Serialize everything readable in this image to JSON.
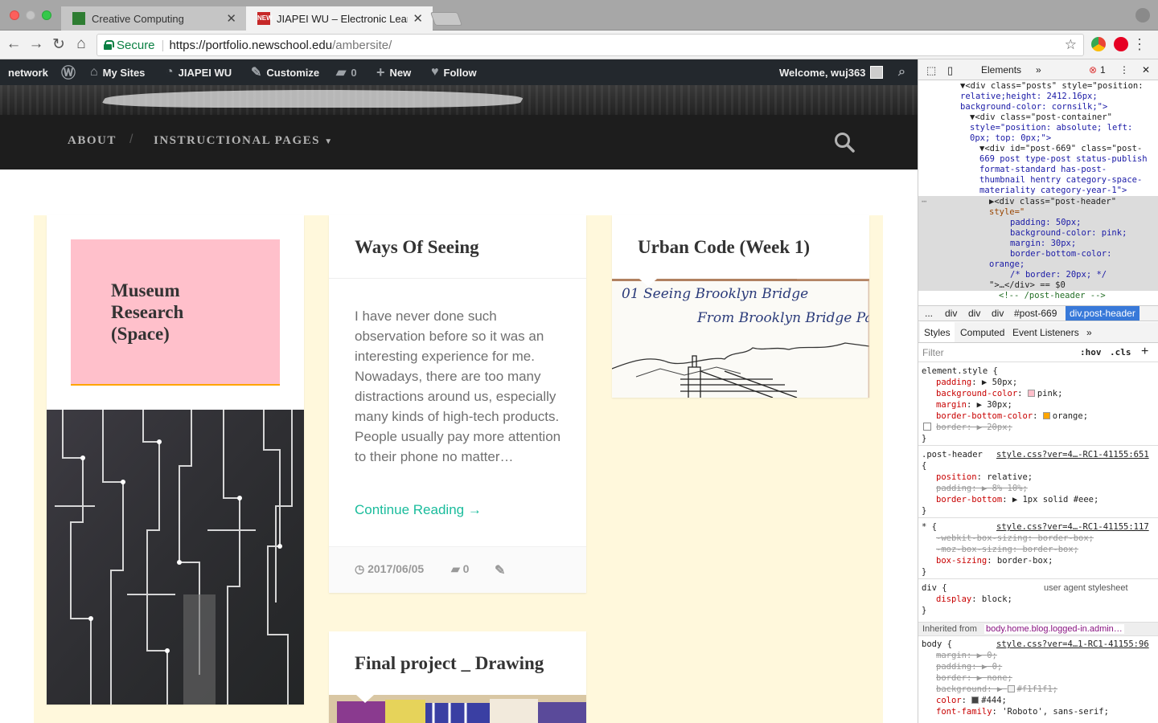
{
  "browser": {
    "tabs": [
      {
        "title": "Creative Computing",
        "favicon_color": "#2e7d32"
      },
      {
        "title": "JIAPEI WU – Electronic Learning",
        "favicon_color": "#c62828",
        "favicon_text": "NEW"
      }
    ],
    "tab_close": "✕",
    "secure_label": "Secure",
    "url_host": "https://portfolio.newschool.edu",
    "url_path": "/ambersite/"
  },
  "adminbar": {
    "network": "network",
    "my_sites": "My Sites",
    "site_name": "JIAPEI WU",
    "customize": "Customize",
    "comments_count": "0",
    "new": "New",
    "follow": "Follow",
    "welcome": "Welcome, wuj363"
  },
  "sitenav": {
    "about": "ABOUT",
    "separator": "/",
    "instructional": "INSTRUCTIONAL PAGES"
  },
  "posts": [
    {
      "title": "Museum Research (Space)"
    },
    {
      "title": "Ways Of Seeing",
      "excerpt": "  I have never done such observation before so it was an interesting experience for me. Nowadays, there are too many distractions around us, especially many kinds of high-tech products. People usually pay more attention to their phone no matter…",
      "continue": "Continue Reading →",
      "date": "2017/06/05",
      "comments": "0"
    },
    {
      "title": "Urban Code (Week 1)",
      "sketch_line1": "01  Seeing  Brooklyn Bridge",
      "sketch_line2": "From  Brooklyn  Bridge Park"
    },
    {
      "title": "Final project _ Drawing"
    }
  ],
  "devtools": {
    "tab_elements": "Elements",
    "errors": "1",
    "dom_lines": [
      "▼<div class=\"posts\" style=\"position:",
      "relative;height: 2412.16px;",
      "background-color: cornsilk;\">",
      "▼<div class=\"post-container\"",
      "style=\"position: absolute; left:",
      "0px; top: 0px;\">",
      "▼<div id=\"post-669\" class=\"post-",
      "669 post type-post status-publish",
      "format-standard has-post-",
      "thumbnail hentry category-space-",
      "materiality category-year-1\">",
      "▶<div class=\"post-header\"",
      "style=\"",
      "padding: 50px;",
      "background-color: pink;",
      "margin: 30px;",
      "border-bottom-color:",
      "orange;",
      "/* border: 20px; */",
      "\">…</div> == $0",
      "<!-- /post-header -->"
    ],
    "crumbs": [
      "...",
      "div",
      "div",
      "div",
      "#post-669",
      "div.post-header"
    ],
    "style_tabs": [
      "Styles",
      "Computed",
      "Event Listeners"
    ],
    "filter_placeholder": "Filter",
    "hov": ":hov",
    "cls": ".cls",
    "rules": {
      "element_style": "element.style {",
      "es_props": [
        [
          "padding",
          "50px;"
        ],
        [
          "background-color",
          "pink;"
        ],
        [
          "margin",
          "30px;"
        ],
        [
          "border-bottom-color",
          "orange;"
        ],
        [
          "border",
          "20px;"
        ]
      ],
      "post_header_sel": ".post-header",
      "post_header_src": "style.css?ver=4…-RC1-41155:651",
      "ph_props": [
        [
          "position",
          "relative;"
        ],
        [
          "padding",
          "8% 10%;"
        ],
        [
          "border-bottom",
          "1px solid #eee;"
        ]
      ],
      "star_sel": "* {",
      "star_src": "style.css?ver=4…-RC1-41155:117",
      "star_props": [
        [
          "-webkit-box-sizing",
          "border-box;"
        ],
        [
          "-moz-box-sizing",
          "border-box;"
        ],
        [
          "box-sizing",
          "border-box;"
        ]
      ],
      "div_sel": "div {",
      "ua": "user agent stylesheet",
      "div_props": [
        [
          "display",
          "block;"
        ]
      ],
      "inherited_label": "Inherited from",
      "inherited_from": "body.home.blog.logged-in.admin…",
      "body_sel": "body {",
      "body_src": "style.css?ver=4…1-RC1-41155:96",
      "body_props": [
        [
          "margin",
          "0;"
        ],
        [
          "padding",
          "0;"
        ],
        [
          "border",
          "none;"
        ],
        [
          "background",
          "#f1f1f1;"
        ],
        [
          "color",
          "#444;"
        ],
        [
          "font-family",
          "'Roboto', sans-serif;"
        ]
      ],
      "close_brace": "}"
    }
  }
}
